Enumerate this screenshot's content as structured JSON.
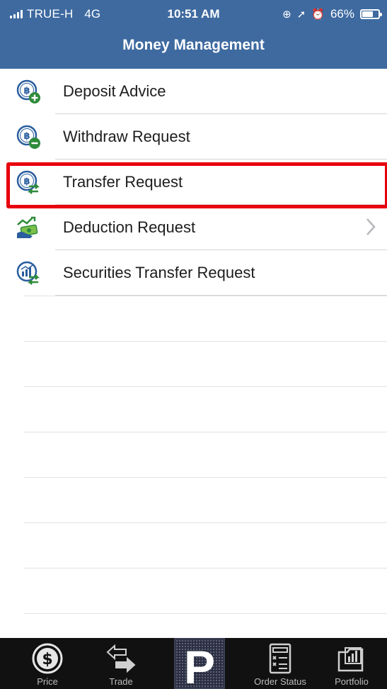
{
  "statusbar": {
    "carrier": "TRUE-H",
    "network": "4G",
    "time": "10:51 AM",
    "battery": "66%",
    "battery_level": 0.66
  },
  "nav": {
    "title": "Money Management"
  },
  "menu": [
    {
      "label": "Deposit Advice",
      "icon": "baht-coin-plus-icon"
    },
    {
      "label": "Withdraw Request",
      "icon": "baht-coin-minus-icon"
    },
    {
      "label": "Transfer Request",
      "icon": "baht-coin-transfer-icon",
      "highlighted": true
    },
    {
      "label": "Deduction Request",
      "icon": "money-deduction-icon",
      "has_disclosure": true
    },
    {
      "label": "Securities Transfer Request",
      "icon": "securities-transfer-icon"
    }
  ],
  "tabbar": {
    "tabs": [
      {
        "label": "Price",
        "icon": "dollar-coin-icon"
      },
      {
        "label": "Trade",
        "icon": "trade-arrows-icon"
      },
      {
        "label": "Order Status",
        "icon": "order-status-icon"
      },
      {
        "label": "Portfolio",
        "icon": "portfolio-icon"
      }
    ],
    "center_logo": "P",
    "center_logo_icon": "app-logo-icon"
  },
  "colors": {
    "header": "#3e6aa0",
    "highlight": "#e8000d",
    "tabbar": "#111111",
    "coin_blue": "#2a5e9e",
    "green": "#2e8b3a"
  }
}
